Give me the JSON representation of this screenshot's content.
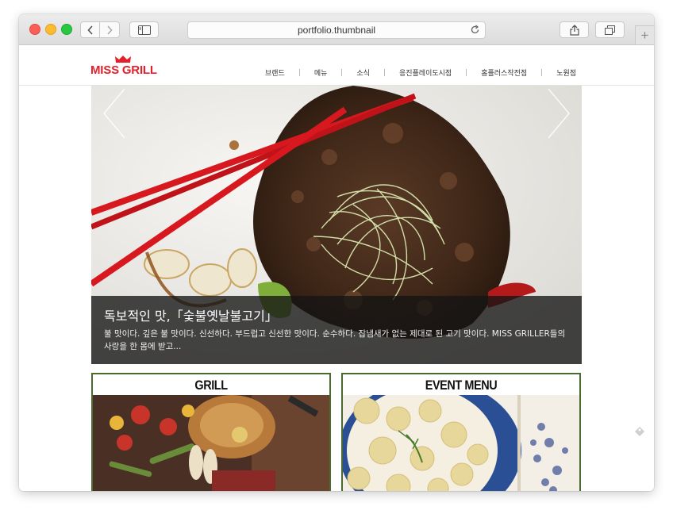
{
  "browser": {
    "url": "portfolio.thumbnail"
  },
  "site": {
    "logo_text": "MISS GRILL",
    "nav": [
      "브랜드",
      "메뉴",
      "소식",
      "응진플레이도시점",
      "홈플러스작전점",
      "노원점"
    ],
    "hero": {
      "title": "독보적인 맛,「숯불옛날불고기」",
      "description": "불 맛이다. 깊은 불 맛이다. 신선하다. 부드럽고 신선한 맛이다. 순수하다. 잡냄새가 없는 제대로 된 고기 맛이다.   MISS GRILLER들의 사랑을 한 몸에 받고..."
    },
    "cards": [
      {
        "title": "GRILL"
      },
      {
        "title": "EVENT MENU"
      }
    ]
  },
  "colors": {
    "brand_red": "#e4212b",
    "card_border": "#4a6b2e"
  },
  "icons": [
    "back-arrow-icon",
    "forward-arrow-icon",
    "sidebar-icon",
    "reload-icon",
    "share-icon",
    "tabs-icon",
    "plus-icon",
    "crown-icon",
    "slider-prev-icon",
    "slider-next-icon",
    "tag-icon"
  ]
}
